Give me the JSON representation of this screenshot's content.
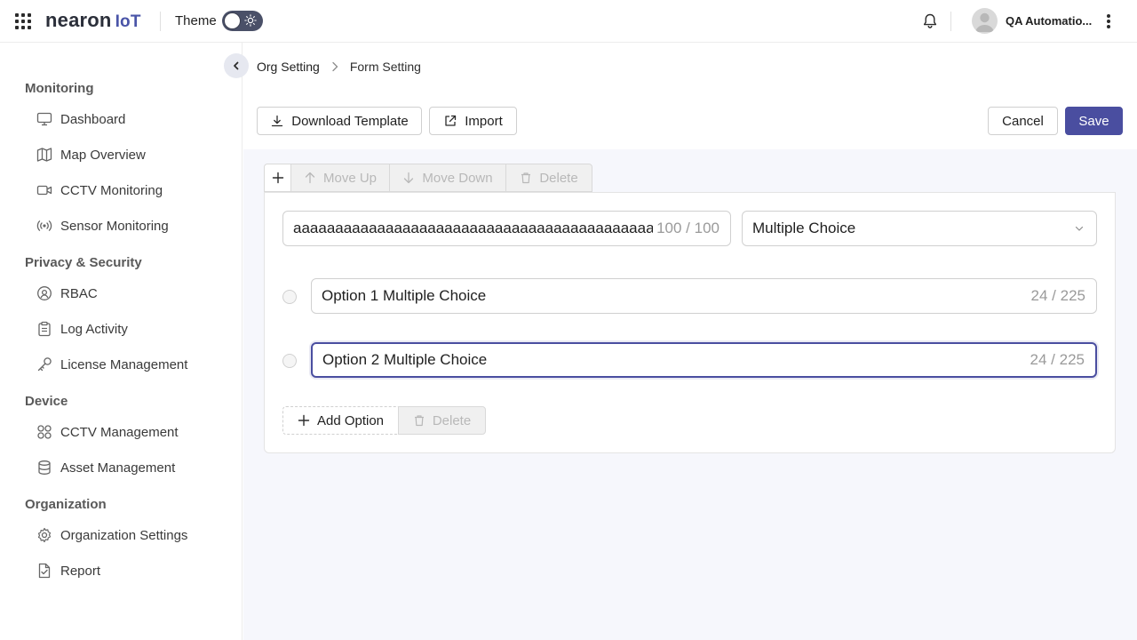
{
  "header": {
    "brand": "nearon",
    "brand_suffix": "IoT",
    "theme_label": "Theme",
    "user_name": "QA Automatio..."
  },
  "sidebar": {
    "sections": [
      {
        "title": "Monitoring",
        "items": [
          {
            "label": "Dashboard",
            "icon": "monitor-icon"
          },
          {
            "label": "Map Overview",
            "icon": "map-icon"
          },
          {
            "label": "CCTV Monitoring",
            "icon": "video-icon"
          },
          {
            "label": "Sensor Monitoring",
            "icon": "sensor-icon"
          }
        ]
      },
      {
        "title": "Privacy & Security",
        "items": [
          {
            "label": "RBAC",
            "icon": "rbac-icon"
          },
          {
            "label": "Log Activity",
            "icon": "clipboard-icon"
          },
          {
            "label": "License Management",
            "icon": "key-icon"
          }
        ]
      },
      {
        "title": "Device",
        "items": [
          {
            "label": "CCTV Management",
            "icon": "grid-icon"
          },
          {
            "label": "Asset Management",
            "icon": "database-icon"
          }
        ]
      },
      {
        "title": "Organization",
        "items": [
          {
            "label": "Organization Settings",
            "icon": "gear-icon"
          },
          {
            "label": "Report",
            "icon": "report-icon"
          }
        ]
      }
    ]
  },
  "breadcrumb": {
    "parent": "Org Setting",
    "current": "Form Setting"
  },
  "toolbar": {
    "download_label": "Download Template",
    "import_label": "Import",
    "cancel_label": "Cancel",
    "save_label": "Save"
  },
  "question_tabs": {
    "add": "+",
    "move_up": "Move Up",
    "move_down": "Move Down",
    "delete": "Delete"
  },
  "question": {
    "title_value": "aaaaaaaaaaaaaaaaaaaaaaaaaaaaaaaaaaaaaaaaaaaaaaaa",
    "title_count": "100 / 100",
    "type_value": "Multiple Choice",
    "options": [
      {
        "value": "Option 1 Multiple Choice",
        "count": "24 / 225"
      },
      {
        "value": "Option 2 Multiple Choice",
        "count": "24 / 225"
      }
    ],
    "add_option_label": "Add Option",
    "delete_option_label": "Delete"
  },
  "colors": {
    "primary": "#4a4ea0",
    "brand_suffix": "#4a55a8",
    "content_background": "#f6f7fc"
  }
}
